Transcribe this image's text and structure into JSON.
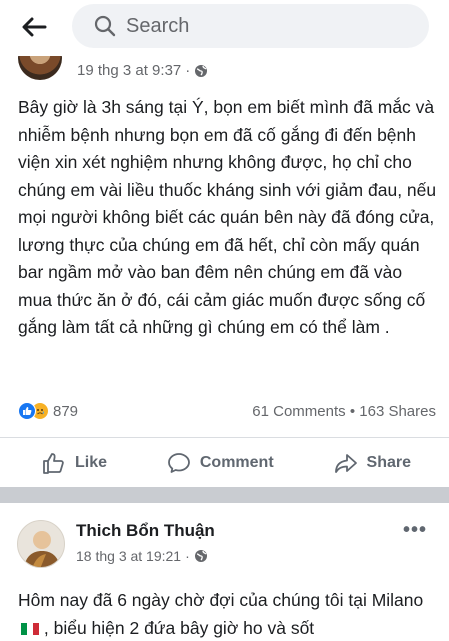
{
  "search": {
    "placeholder": "Search"
  },
  "post1": {
    "timestamp": "19 thg 3 at 9:37",
    "separator": "·",
    "body": "Bây giờ là 3h sáng tại Ý, bọn em biết mình đã mắc và nhiễm bệnh nhưng bọn em đã cố gắng đi đến bệnh viện xin xét nghiệm nhưng không được, họ chỉ cho chúng em vài liều thuốc kháng sinh với giảm đau, nếu mọi người không biết các quán bên này đã đóng cửa, lương thực của chúng em đã hết, chỉ còn mấy quán bar ngầm mở vào ban đêm nên chúng em đã vào mua thức ăn ở đó, cái cảm giác muốn được sống cố gắng làm tất cả những gì chúng em có thể làm .",
    "reaction_count": "879",
    "comments": "61 Comments",
    "dot": "•",
    "shares": "163 Shares",
    "reactions": [
      "like-icon",
      "sad-icon"
    ]
  },
  "actions": {
    "like": "Like",
    "comment": "Comment",
    "share": "Share"
  },
  "post2": {
    "author": "Thich Bổn Thuận",
    "timestamp": "18 thg 3 at 19:21",
    "separator": "·",
    "more": "•••",
    "body_start": "Hôm nay đã 6 ngày chờ đợi của chúng tôi tại Milano",
    "body_end": " , biểu hiện 2 đứa bây giờ ho và sốt"
  },
  "colors": {
    "accent": "#1877f2",
    "sad": "#f7b125",
    "separator": "#c9ccd1",
    "muted": "#65676b"
  }
}
